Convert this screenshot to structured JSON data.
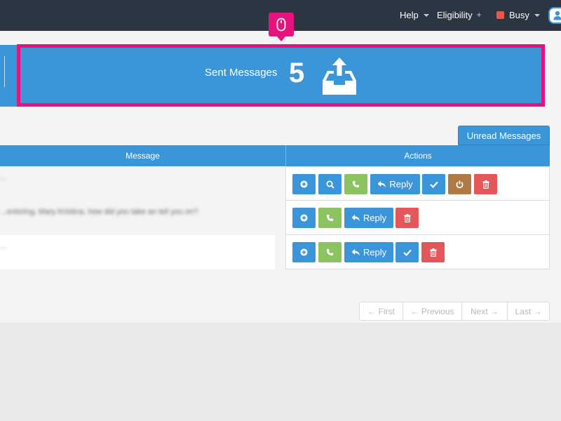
{
  "navbar": {
    "help_label": "Help",
    "eligibility_label": "Eligibility",
    "eligibility_plus": "+",
    "status_label": "Busy",
    "status_color": "#e05a4f"
  },
  "banner": {
    "title": "Sent Messages",
    "count": "5",
    "icon": "outbox-upload-icon",
    "highlight_color": "#e8127f",
    "marker_icon": "mouse-icon"
  },
  "unread_tab": {
    "label": "Unread Messages"
  },
  "table": {
    "columns": [
      "Message",
      "Actions"
    ],
    "rows": [
      {
        "message": "...",
        "actions": [
          "add",
          "search",
          "call",
          "Reply",
          "check",
          "power",
          "delete"
        ]
      },
      {
        "message": "...ontoring, Mary Kristina, how did you take an tell you on?",
        "actions": [
          "add",
          "call",
          "Reply",
          "delete"
        ]
      },
      {
        "message": "...",
        "actions": [
          "add",
          "call",
          "Reply",
          "check",
          "delete"
        ]
      }
    ],
    "reply_label": "Reply"
  },
  "pagination": {
    "first": "← First",
    "previous": "← Previous",
    "next": "Next →",
    "last": "Last →"
  },
  "colors": {
    "primary": "#3a96d8",
    "success": "#8cc360",
    "danger": "#e3575b",
    "warning": "#b07a46",
    "navbar": "#2c3542"
  }
}
